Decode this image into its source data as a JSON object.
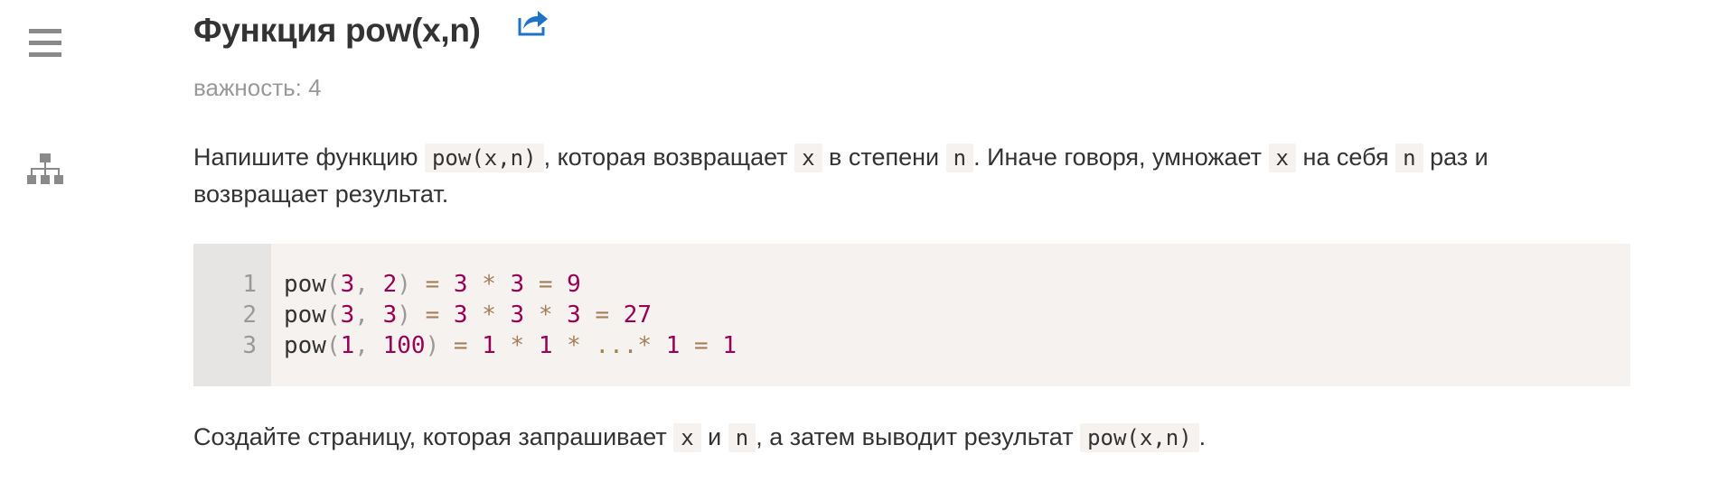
{
  "sidebar": {
    "menu_icon": "hamburger-menu-icon",
    "sitemap_icon": "sitemap-icon"
  },
  "task": {
    "title": "Функция pow(x,n)",
    "share_icon": "share-icon",
    "importance": "важность: 4"
  },
  "description": {
    "p1_t1": "Напишите функцию ",
    "p1_c1": "pow(x,n)",
    "p1_t2": ", которая возвращает ",
    "p1_c2": "x",
    "p1_t3": " в степени ",
    "p1_c3": "n",
    "p1_t4": ". Иначе говоря, умножает ",
    "p1_c4": "x",
    "p1_t5": " на себя ",
    "p1_c5": "n",
    "p1_t6": " раз и возвращает результат.",
    "p2_t1": "Создайте страницу, которая запрашивает ",
    "p2_c1": "x",
    "p2_t2": " и ",
    "p2_c2": "n",
    "p2_t3": ", а затем выводит результат ",
    "p2_c3": "pow(x,n)",
    "p2_t4": "."
  },
  "code_example": {
    "line_numbers": [
      "1",
      "2",
      "3"
    ],
    "lines": [
      [
        {
          "t": "pow",
          "k": "fn"
        },
        {
          "t": "(",
          "k": "punc"
        },
        {
          "t": "3",
          "k": "num"
        },
        {
          "t": ",",
          "k": "punc"
        },
        {
          "t": " ",
          "k": "fn"
        },
        {
          "t": "2",
          "k": "num"
        },
        {
          "t": ")",
          "k": "punc"
        },
        {
          "t": " ",
          "k": "fn"
        },
        {
          "t": "=",
          "k": "op"
        },
        {
          "t": " ",
          "k": "fn"
        },
        {
          "t": "3",
          "k": "num"
        },
        {
          "t": " ",
          "k": "fn"
        },
        {
          "t": "*",
          "k": "op"
        },
        {
          "t": " ",
          "k": "fn"
        },
        {
          "t": "3",
          "k": "num"
        },
        {
          "t": " ",
          "k": "fn"
        },
        {
          "t": "=",
          "k": "op"
        },
        {
          "t": " ",
          "k": "fn"
        },
        {
          "t": "9",
          "k": "num"
        }
      ],
      [
        {
          "t": "pow",
          "k": "fn"
        },
        {
          "t": "(",
          "k": "punc"
        },
        {
          "t": "3",
          "k": "num"
        },
        {
          "t": ",",
          "k": "punc"
        },
        {
          "t": " ",
          "k": "fn"
        },
        {
          "t": "3",
          "k": "num"
        },
        {
          "t": ")",
          "k": "punc"
        },
        {
          "t": " ",
          "k": "fn"
        },
        {
          "t": "=",
          "k": "op"
        },
        {
          "t": " ",
          "k": "fn"
        },
        {
          "t": "3",
          "k": "num"
        },
        {
          "t": " ",
          "k": "fn"
        },
        {
          "t": "*",
          "k": "op"
        },
        {
          "t": " ",
          "k": "fn"
        },
        {
          "t": "3",
          "k": "num"
        },
        {
          "t": " ",
          "k": "fn"
        },
        {
          "t": "*",
          "k": "op"
        },
        {
          "t": " ",
          "k": "fn"
        },
        {
          "t": "3",
          "k": "num"
        },
        {
          "t": " ",
          "k": "fn"
        },
        {
          "t": "=",
          "k": "op"
        },
        {
          "t": " ",
          "k": "fn"
        },
        {
          "t": "27",
          "k": "num"
        }
      ],
      [
        {
          "t": "pow",
          "k": "fn"
        },
        {
          "t": "(",
          "k": "punc"
        },
        {
          "t": "1",
          "k": "num"
        },
        {
          "t": ",",
          "k": "punc"
        },
        {
          "t": " ",
          "k": "fn"
        },
        {
          "t": "100",
          "k": "num"
        },
        {
          "t": ")",
          "k": "punc"
        },
        {
          "t": " ",
          "k": "fn"
        },
        {
          "t": "=",
          "k": "op"
        },
        {
          "t": " ",
          "k": "fn"
        },
        {
          "t": "1",
          "k": "num"
        },
        {
          "t": " ",
          "k": "fn"
        },
        {
          "t": "*",
          "k": "op"
        },
        {
          "t": " ",
          "k": "fn"
        },
        {
          "t": "1",
          "k": "num"
        },
        {
          "t": " ",
          "k": "fn"
        },
        {
          "t": "*",
          "k": "op"
        },
        {
          "t": " ",
          "k": "fn"
        },
        {
          "t": "...",
          "k": "op"
        },
        {
          "t": "*",
          "k": "op"
        },
        {
          "t": " ",
          "k": "fn"
        },
        {
          "t": "1",
          "k": "num"
        },
        {
          "t": " ",
          "k": "fn"
        },
        {
          "t": "=",
          "k": "op"
        },
        {
          "t": " ",
          "k": "fn"
        },
        {
          "t": "1",
          "k": "num"
        }
      ]
    ]
  },
  "colors": {
    "text": "#333333",
    "muted": "#999999",
    "link": "#1f73c7",
    "code_bg": "#f5f2f0",
    "gutter_bg": "#e7e5e3",
    "number": "#990055",
    "operator": "#a67f59",
    "icon": "#8a8a8a"
  }
}
